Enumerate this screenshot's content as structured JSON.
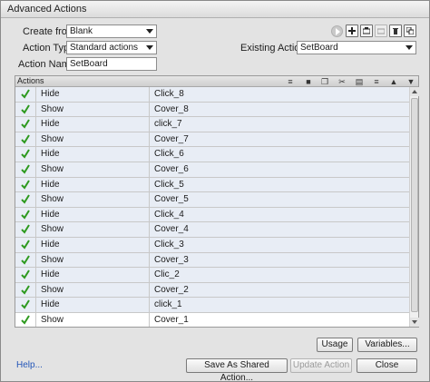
{
  "window": {
    "title": "Advanced Actions"
  },
  "form": {
    "create_from_label": "Create from:",
    "create_from_value": "Blank",
    "action_type_label": "Action Type:",
    "action_type_value": "Standard actions",
    "action_name_label": "Action Name:",
    "action_name_value": "SetBoard",
    "existing_actions_label": "Existing Actions:",
    "existing_actions_value": "SetBoard"
  },
  "actions": {
    "header": "Actions",
    "rows": [
      {
        "action": "Hide",
        "target": "Click_8"
      },
      {
        "action": "Show",
        "target": "Cover_8"
      },
      {
        "action": "Hide",
        "target": "click_7"
      },
      {
        "action": "Show",
        "target": "Cover_7"
      },
      {
        "action": "Hide",
        "target": "Click_6"
      },
      {
        "action": "Show",
        "target": "Cover_6"
      },
      {
        "action": "Hide",
        "target": "Click_5"
      },
      {
        "action": "Show",
        "target": "Cover_5"
      },
      {
        "action": "Hide",
        "target": "Click_4"
      },
      {
        "action": "Show",
        "target": "Cover_4"
      },
      {
        "action": "Hide",
        "target": "Click_3"
      },
      {
        "action": "Show",
        "target": "Cover_3"
      },
      {
        "action": "Hide",
        "target": "Clic_2"
      },
      {
        "action": "Show",
        "target": "Cover_2"
      },
      {
        "action": "Hide",
        "target": "click_1"
      },
      {
        "action": "Show",
        "target": "Cover_1"
      }
    ]
  },
  "buttons": {
    "usage": "Usage",
    "variables": "Variables...",
    "save_shared": "Save As Shared Action...",
    "update_action": "Update Action",
    "close": "Close"
  },
  "help_link": "Help...",
  "icons": {
    "check": "check-icon",
    "play": "preview-play-icon"
  },
  "colors": {
    "check_green": "#2e9a1f",
    "row_bg": "#e8edf5",
    "link": "#2356b8"
  }
}
